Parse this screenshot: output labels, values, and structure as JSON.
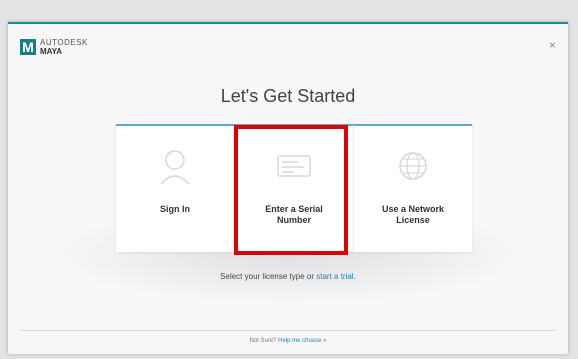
{
  "header": {
    "logo_letter": "M",
    "vendor": "AUTODESK",
    "product": "MAYA",
    "close_glyph": "×"
  },
  "title": "Let's Get Started",
  "options": [
    {
      "label": "Sign In",
      "icon": "user-icon"
    },
    {
      "label": "Enter a Serial Number",
      "icon": "serial-card-icon"
    },
    {
      "label": "Use a Network License",
      "icon": "network-globe-icon"
    }
  ],
  "license_prompt": {
    "text": "Select your license type or",
    "link": "start a trial",
    "suffix": "."
  },
  "footer": {
    "text": "Not Sure?",
    "link": "Help me choose »"
  },
  "colors": {
    "accent_teal": "#1b8a8f",
    "option_border": "#5aa6d6",
    "highlight_red": "#e00000",
    "link_blue": "#2a7fc1"
  }
}
